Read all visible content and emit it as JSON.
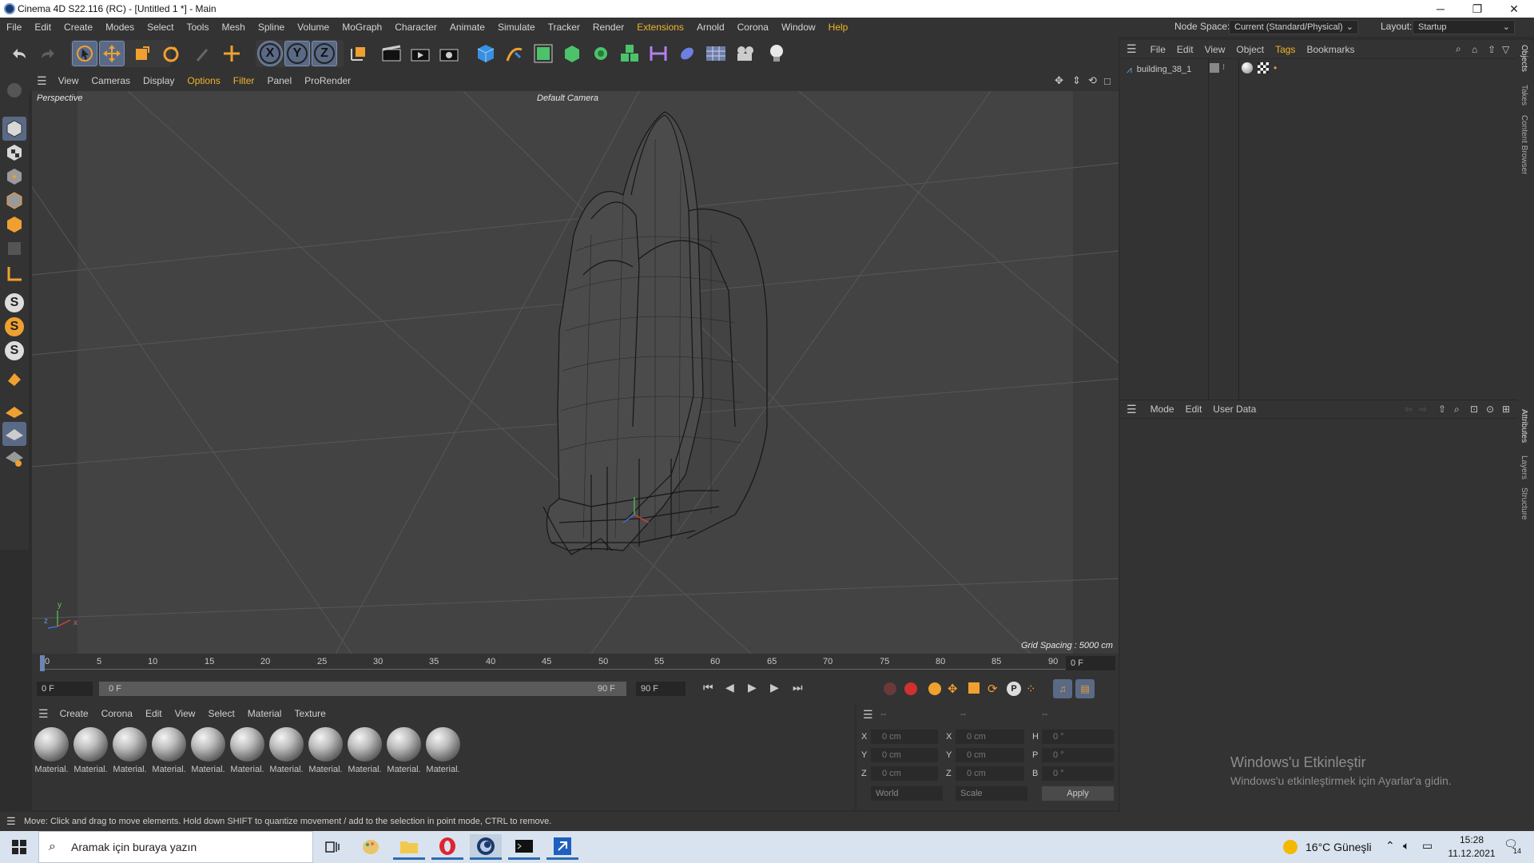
{
  "window": {
    "title": "Cinema 4D S22.116 (RC) - [Untitled 1 *] - Main",
    "minimize": "─",
    "restore": "❐",
    "close": "✕"
  },
  "menubar": {
    "items": [
      "File",
      "Edit",
      "Create",
      "Modes",
      "Select",
      "Tools",
      "Mesh",
      "Spline",
      "Volume",
      "MoGraph",
      "Character",
      "Animate",
      "Simulate",
      "Tracker",
      "Render",
      "Extensions",
      "Arnold",
      "Corona",
      "Window",
      "Help"
    ],
    "node_space_label": "Node Space:",
    "node_space_value": "Current (Standard/Physical)",
    "layout_label": "Layout:",
    "layout_value": "Startup"
  },
  "toolbar": {
    "axis_x": "X",
    "axis_y": "Y",
    "axis_z": "Z"
  },
  "viewport_menu": {
    "items": [
      "View",
      "Cameras",
      "Display",
      "Options",
      "Filter",
      "Panel",
      "ProRender"
    ]
  },
  "viewport": {
    "name": "Perspective",
    "camera": "Default Camera",
    "grid_spacing": "Grid Spacing : 5000 cm",
    "axis_y": "y",
    "axis_z": "z",
    "axis_x": "x"
  },
  "left_tools": {
    "s1": "S",
    "s2": "S",
    "s3": "S"
  },
  "object_manager": {
    "menu": [
      "File",
      "Edit",
      "View",
      "Object",
      "Tags",
      "Bookmarks"
    ],
    "object_name": "building_38_1"
  },
  "attribute_manager": {
    "menu": [
      "Mode",
      "Edit",
      "User Data"
    ]
  },
  "right_tabs": [
    "Objects",
    "Takes",
    "Content Browser",
    "Attributes",
    "Layers",
    "Structure"
  ],
  "timeline": {
    "ticks": [
      "0",
      "5",
      "10",
      "15",
      "20",
      "25",
      "30",
      "35",
      "40",
      "45",
      "50",
      "55",
      "60",
      "65",
      "70",
      "75",
      "80",
      "85",
      "90"
    ],
    "current_frame": "0 F"
  },
  "transport": {
    "start_field": "0 F",
    "range_start": "0 F",
    "range_end": "90 F",
    "end_field": "90 F"
  },
  "material_manager": {
    "menu": [
      "Create",
      "Corona",
      "Edit",
      "View",
      "Select",
      "Material",
      "Texture"
    ],
    "materials": [
      "Material.",
      "Material.",
      "Material.",
      "Material.",
      "Material.",
      "Material.",
      "Material.",
      "Material.",
      "Material.",
      "Material.",
      "Material."
    ]
  },
  "coordinates": {
    "header": [
      "--",
      "--",
      "--"
    ],
    "pos": [
      {
        "label": "X",
        "value": "0 cm"
      },
      {
        "label": "Y",
        "value": "0 cm"
      },
      {
        "label": "Z",
        "value": "0 cm"
      }
    ],
    "size": [
      {
        "label": "X",
        "value": "0 cm"
      },
      {
        "label": "Y",
        "value": "0 cm"
      },
      {
        "label": "Z",
        "value": "0 cm"
      }
    ],
    "rot": [
      {
        "label": "H",
        "value": "0 °"
      },
      {
        "label": "P",
        "value": "0 °"
      },
      {
        "label": "B",
        "value": "0 °"
      }
    ],
    "mode_world": "World",
    "mode_scale": "Scale",
    "apply": "Apply"
  },
  "status": {
    "text": "Move: Click and drag to move elements. Hold down SHIFT to quantize movement / add to the selection in point mode, CTRL to remove."
  },
  "watermark": {
    "title": "Windows'u Etkinleştir",
    "subtitle": "Windows'u etkinleştirmek için Ayarlar'a gidin."
  },
  "taskbar": {
    "search_placeholder": "Aramak için buraya yazın",
    "weather": "16°C  Güneşli",
    "time": "15:28",
    "date": "11.12.2021",
    "notifications": "14"
  },
  "colors": {
    "accent": "#f0b429",
    "selected": "#5a6a86",
    "viewport_bg": "#424242"
  }
}
